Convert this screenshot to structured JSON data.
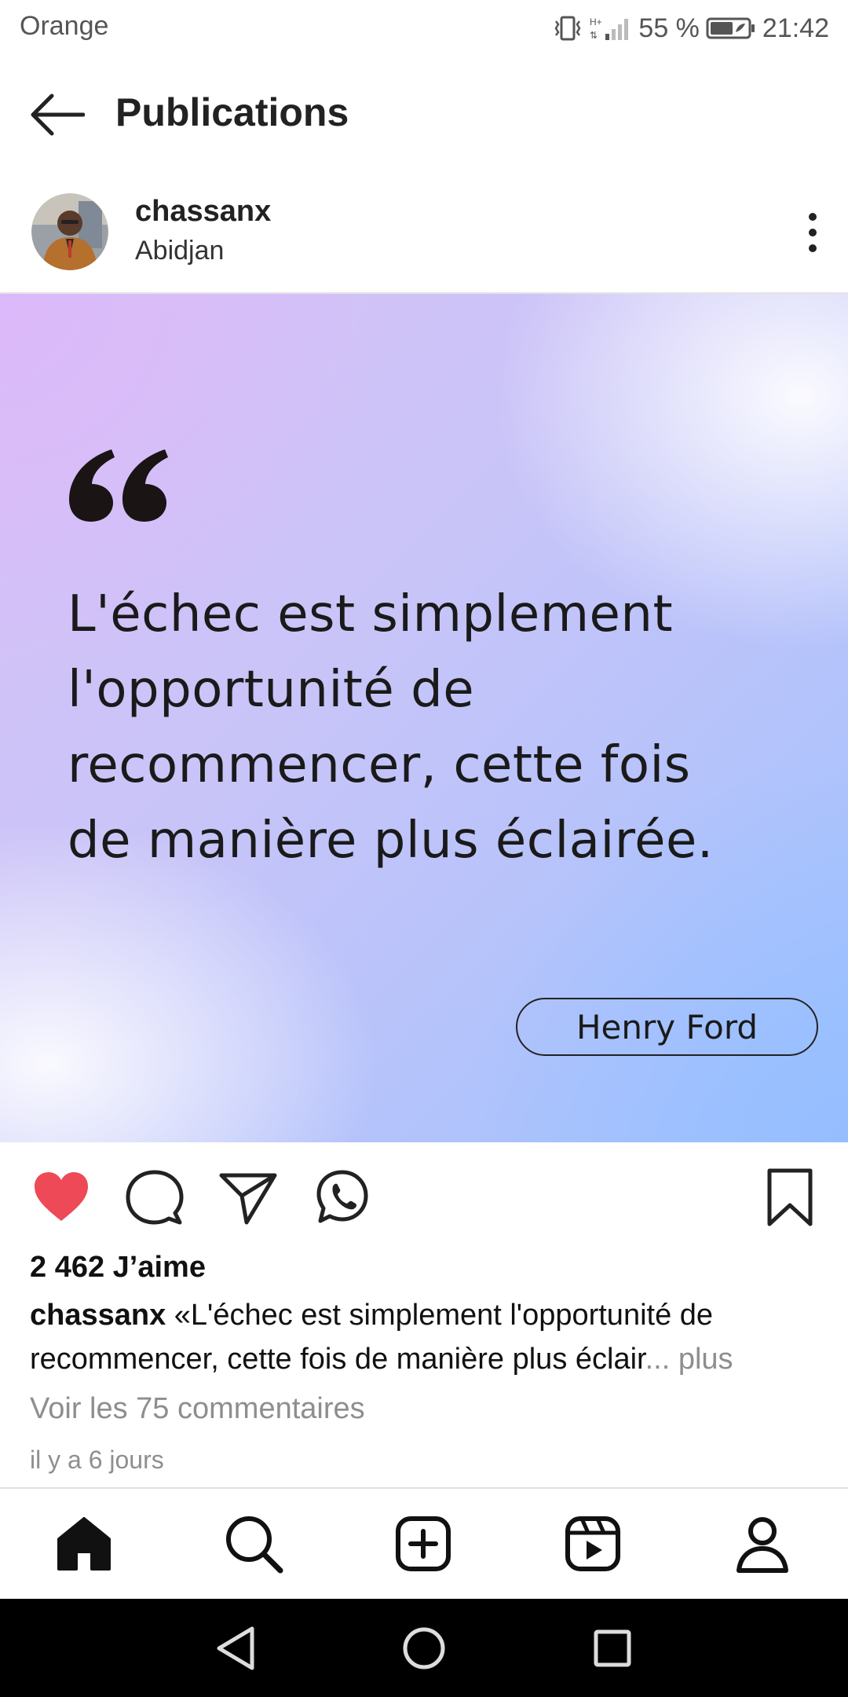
{
  "status_bar": {
    "carrier": "Orange",
    "battery_percent": "55 %",
    "time": "21:42",
    "icons": [
      "vibrate-icon",
      "signal-icon",
      "battery-icon"
    ]
  },
  "header": {
    "back_icon": "arrow-left-icon",
    "title": "Publications"
  },
  "post": {
    "username": "chassanx",
    "location": "Abidjan",
    "more_icon": "more-vertical-icon",
    "image": {
      "quote_lines": [
        "L'échec est simplement",
        "l'opportunité de",
        "recommencer, cette fois",
        "de manière plus éclairée."
      ],
      "author": "Henry Ford"
    },
    "actions": {
      "like_icon": "heart-filled-icon",
      "comment_icon": "comment-icon",
      "share_icon": "send-icon",
      "whatsapp_icon": "whatsapp-icon",
      "save_icon": "bookmark-icon",
      "like_color": "#ED4956"
    },
    "likes": "2 462 J’aime",
    "caption": {
      "user": "chassanx",
      "text_line1": " «L'échec est simplement l'opportunité de",
      "text_line2": "recommencer, cette fois de manière plus éclair",
      "more": "... plus"
    },
    "comments_link": "Voir les 75 commentaires",
    "timestamp": "il y a 6 jours"
  },
  "bottom_nav": [
    "home-icon",
    "search-icon",
    "add-post-icon",
    "reels-icon",
    "profile-icon"
  ],
  "system_nav": [
    "back-triangle-icon",
    "home-circle-icon",
    "recents-square-icon"
  ]
}
